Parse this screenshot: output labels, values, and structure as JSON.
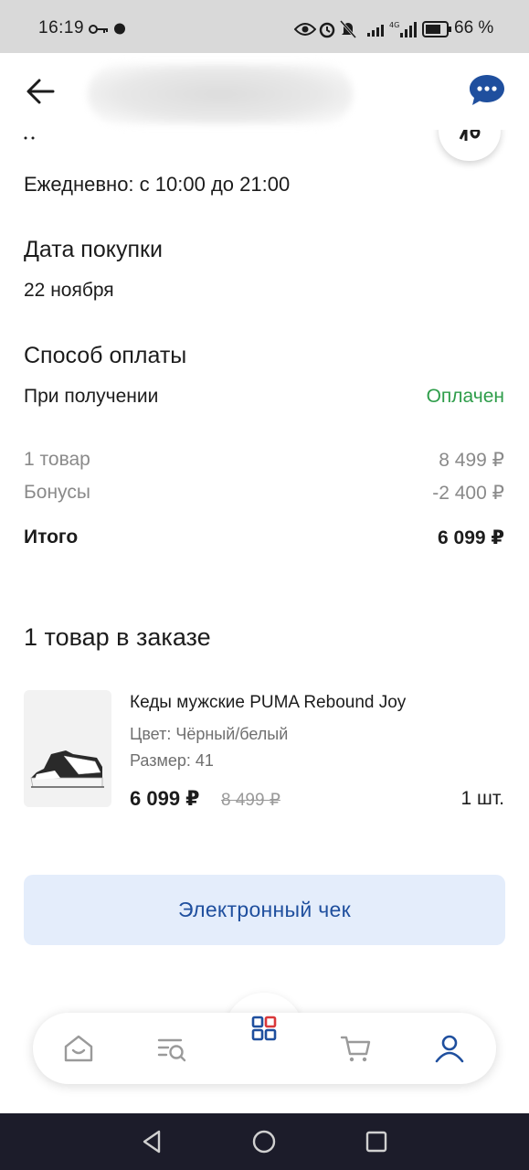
{
  "status_bar": {
    "time": "16:19",
    "battery": "66 %"
  },
  "header": {
    "back_icon": "arrow-left-icon",
    "chat_icon": "chat-bubble-icon"
  },
  "store": {
    "schedule": "Ежедневно: с 10:00 до 21:00"
  },
  "purchase_date": {
    "title": "Дата покупки",
    "value": "22 ноября"
  },
  "payment": {
    "title": "Способ оплаты",
    "method": "При получении",
    "status": "Оплачен",
    "status_color": "#2e9d4a"
  },
  "summary": {
    "items_label": "1 товар",
    "items_value": "8 499 ₽",
    "bonus_label": "Бонусы",
    "bonus_value": "-2 400 ₽",
    "total_label": "Итого",
    "total_value": "6 099 ₽"
  },
  "order_items": {
    "title": "1 товар в заказе",
    "items": [
      {
        "name": "Кеды мужские PUMA Rebound Joy",
        "color": "Цвет: Чёрный/белый",
        "size": "Размер: 41",
        "price": "6 099 ₽",
        "old_price": "8 499 ₽",
        "quantity": "1 шт."
      }
    ]
  },
  "receipt_button": {
    "label": "Электронный чек",
    "bg_color": "#e4edfb",
    "text_color": "#1f4f9e"
  },
  "bottom_nav": {
    "items": [
      "home-icon",
      "search-list-icon",
      "catalog-grid-icon",
      "cart-icon",
      "profile-icon"
    ],
    "active": "profile-icon",
    "accent": "#1f4f9e"
  }
}
